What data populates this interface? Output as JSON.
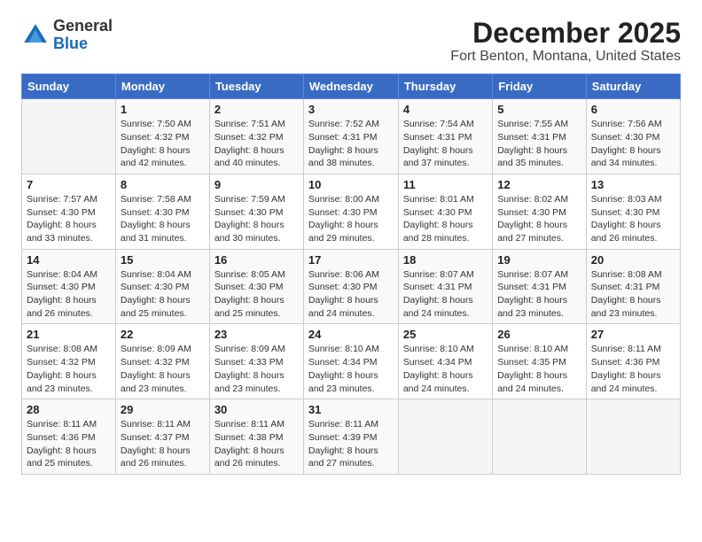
{
  "header": {
    "logo_line1": "General",
    "logo_line2": "Blue",
    "title": "December 2025",
    "subtitle": "Fort Benton, Montana, United States"
  },
  "weekdays": [
    "Sunday",
    "Monday",
    "Tuesday",
    "Wednesday",
    "Thursday",
    "Friday",
    "Saturday"
  ],
  "weeks": [
    [
      {
        "day": "",
        "info": ""
      },
      {
        "day": "1",
        "info": "Sunrise: 7:50 AM\nSunset: 4:32 PM\nDaylight: 8 hours\nand 42 minutes."
      },
      {
        "day": "2",
        "info": "Sunrise: 7:51 AM\nSunset: 4:32 PM\nDaylight: 8 hours\nand 40 minutes."
      },
      {
        "day": "3",
        "info": "Sunrise: 7:52 AM\nSunset: 4:31 PM\nDaylight: 8 hours\nand 38 minutes."
      },
      {
        "day": "4",
        "info": "Sunrise: 7:54 AM\nSunset: 4:31 PM\nDaylight: 8 hours\nand 37 minutes."
      },
      {
        "day": "5",
        "info": "Sunrise: 7:55 AM\nSunset: 4:31 PM\nDaylight: 8 hours\nand 35 minutes."
      },
      {
        "day": "6",
        "info": "Sunrise: 7:56 AM\nSunset: 4:30 PM\nDaylight: 8 hours\nand 34 minutes."
      }
    ],
    [
      {
        "day": "7",
        "info": "Sunrise: 7:57 AM\nSunset: 4:30 PM\nDaylight: 8 hours\nand 33 minutes."
      },
      {
        "day": "8",
        "info": "Sunrise: 7:58 AM\nSunset: 4:30 PM\nDaylight: 8 hours\nand 31 minutes."
      },
      {
        "day": "9",
        "info": "Sunrise: 7:59 AM\nSunset: 4:30 PM\nDaylight: 8 hours\nand 30 minutes."
      },
      {
        "day": "10",
        "info": "Sunrise: 8:00 AM\nSunset: 4:30 PM\nDaylight: 8 hours\nand 29 minutes."
      },
      {
        "day": "11",
        "info": "Sunrise: 8:01 AM\nSunset: 4:30 PM\nDaylight: 8 hours\nand 28 minutes."
      },
      {
        "day": "12",
        "info": "Sunrise: 8:02 AM\nSunset: 4:30 PM\nDaylight: 8 hours\nand 27 minutes."
      },
      {
        "day": "13",
        "info": "Sunrise: 8:03 AM\nSunset: 4:30 PM\nDaylight: 8 hours\nand 26 minutes."
      }
    ],
    [
      {
        "day": "14",
        "info": "Sunrise: 8:04 AM\nSunset: 4:30 PM\nDaylight: 8 hours\nand 26 minutes."
      },
      {
        "day": "15",
        "info": "Sunrise: 8:04 AM\nSunset: 4:30 PM\nDaylight: 8 hours\nand 25 minutes."
      },
      {
        "day": "16",
        "info": "Sunrise: 8:05 AM\nSunset: 4:30 PM\nDaylight: 8 hours\nand 25 minutes."
      },
      {
        "day": "17",
        "info": "Sunrise: 8:06 AM\nSunset: 4:30 PM\nDaylight: 8 hours\nand 24 minutes."
      },
      {
        "day": "18",
        "info": "Sunrise: 8:07 AM\nSunset: 4:31 PM\nDaylight: 8 hours\nand 24 minutes."
      },
      {
        "day": "19",
        "info": "Sunrise: 8:07 AM\nSunset: 4:31 PM\nDaylight: 8 hours\nand 23 minutes."
      },
      {
        "day": "20",
        "info": "Sunrise: 8:08 AM\nSunset: 4:31 PM\nDaylight: 8 hours\nand 23 minutes."
      }
    ],
    [
      {
        "day": "21",
        "info": "Sunrise: 8:08 AM\nSunset: 4:32 PM\nDaylight: 8 hours\nand 23 minutes."
      },
      {
        "day": "22",
        "info": "Sunrise: 8:09 AM\nSunset: 4:32 PM\nDaylight: 8 hours\nand 23 minutes."
      },
      {
        "day": "23",
        "info": "Sunrise: 8:09 AM\nSunset: 4:33 PM\nDaylight: 8 hours\nand 23 minutes."
      },
      {
        "day": "24",
        "info": "Sunrise: 8:10 AM\nSunset: 4:34 PM\nDaylight: 8 hours\nand 23 minutes."
      },
      {
        "day": "25",
        "info": "Sunrise: 8:10 AM\nSunset: 4:34 PM\nDaylight: 8 hours\nand 24 minutes."
      },
      {
        "day": "26",
        "info": "Sunrise: 8:10 AM\nSunset: 4:35 PM\nDaylight: 8 hours\nand 24 minutes."
      },
      {
        "day": "27",
        "info": "Sunrise: 8:11 AM\nSunset: 4:36 PM\nDaylight: 8 hours\nand 24 minutes."
      }
    ],
    [
      {
        "day": "28",
        "info": "Sunrise: 8:11 AM\nSunset: 4:36 PM\nDaylight: 8 hours\nand 25 minutes."
      },
      {
        "day": "29",
        "info": "Sunrise: 8:11 AM\nSunset: 4:37 PM\nDaylight: 8 hours\nand 26 minutes."
      },
      {
        "day": "30",
        "info": "Sunrise: 8:11 AM\nSunset: 4:38 PM\nDaylight: 8 hours\nand 26 minutes."
      },
      {
        "day": "31",
        "info": "Sunrise: 8:11 AM\nSunset: 4:39 PM\nDaylight: 8 hours\nand 27 minutes."
      },
      {
        "day": "",
        "info": ""
      },
      {
        "day": "",
        "info": ""
      },
      {
        "day": "",
        "info": ""
      }
    ]
  ]
}
